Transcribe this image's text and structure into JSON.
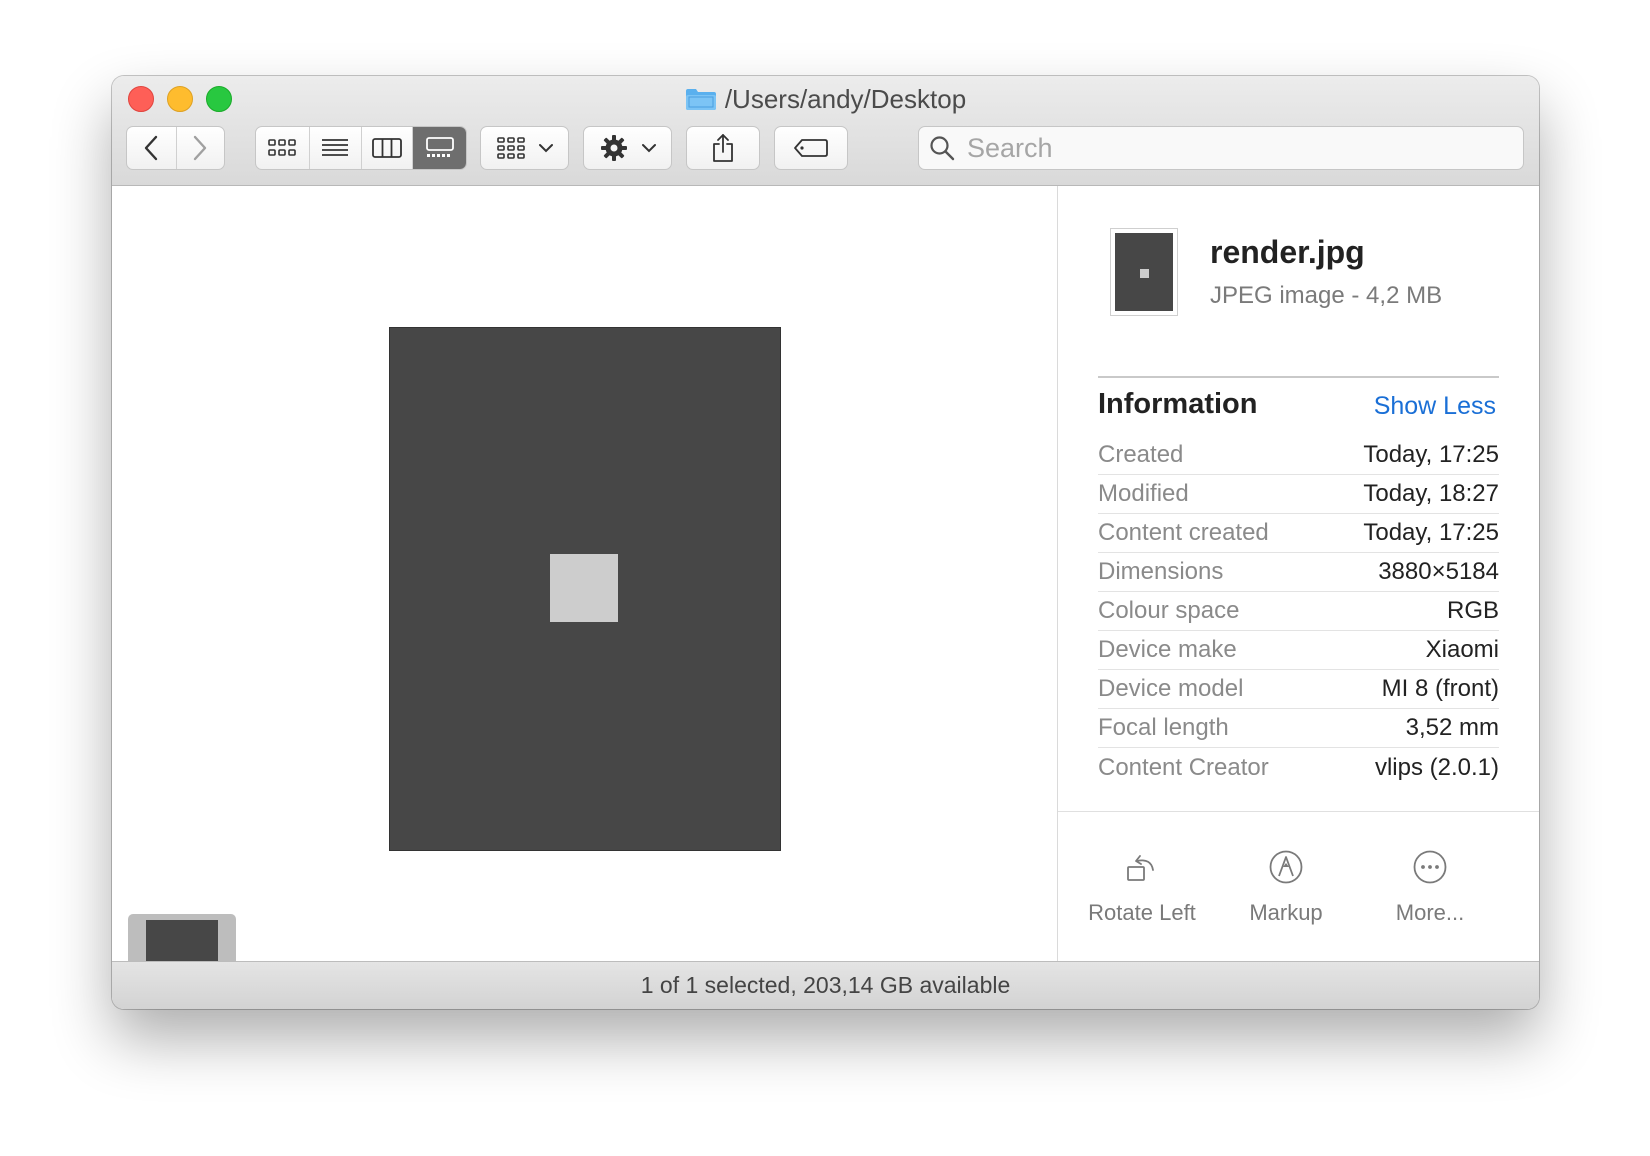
{
  "window": {
    "title": "/Users/andy/Desktop"
  },
  "toolbar": {
    "back_icon": "chevron-left-icon",
    "forward_icon": "chevron-right-icon",
    "view_modes": [
      "icon-view-icon",
      "list-view-icon",
      "column-view-icon",
      "gallery-view-icon"
    ],
    "active_view": "gallery",
    "group_icon": "group-by-icon",
    "action_icon": "gear-icon",
    "share_icon": "share-icon",
    "tag_icon": "tag-icon",
    "search_placeholder": "Search"
  },
  "inspector": {
    "file_name": "render.jpg",
    "file_desc": "JPEG image - 4,2 MB",
    "info_heading": "Information",
    "show_less": "Show Less",
    "rows": [
      {
        "key": "Created",
        "value": "Today, 17:25"
      },
      {
        "key": "Modified",
        "value": "Today, 18:27"
      },
      {
        "key": "Content created",
        "value": "Today, 17:25"
      },
      {
        "key": "Dimensions",
        "value": "3880×5184"
      },
      {
        "key": "Colour space",
        "value": "RGB"
      },
      {
        "key": "Device make",
        "value": "Xiaomi"
      },
      {
        "key": "Device model",
        "value": "MI 8 (front)"
      },
      {
        "key": "Focal length",
        "value": "3,52 mm"
      },
      {
        "key": "Content Creator",
        "value": "vlips (2.0.1)"
      }
    ],
    "actions": [
      {
        "label": "Rotate Left",
        "icon": "rotate-left-icon"
      },
      {
        "label": "Markup",
        "icon": "markup-icon"
      },
      {
        "label": "More...",
        "icon": "more-icon"
      }
    ]
  },
  "status": {
    "text": "1 of 1 selected, 203,14 GB available"
  },
  "colors": {
    "accent": "#1a6fd6",
    "preview_bg": "#474747",
    "preview_square": "#cdcdcd"
  }
}
